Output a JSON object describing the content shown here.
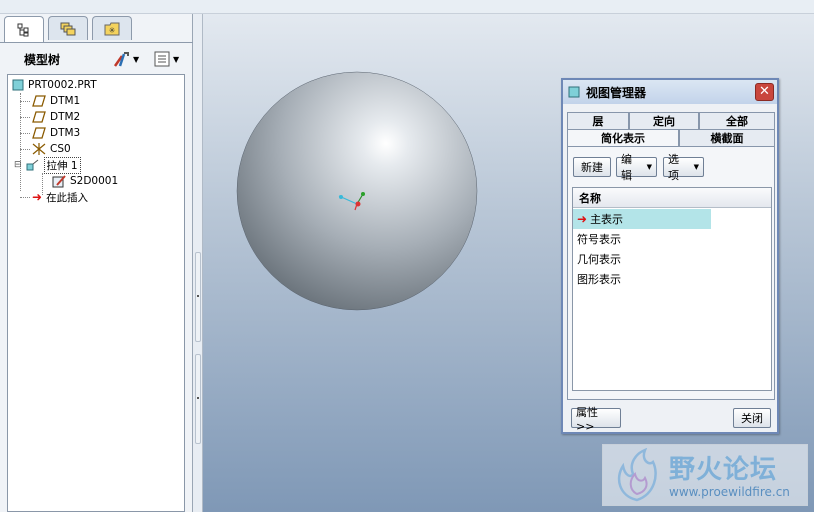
{
  "left_panel": {
    "title": "模型树",
    "tabs": [
      {
        "icon": "model-tree-icon",
        "active": true
      },
      {
        "icon": "layers-icon",
        "active": false
      },
      {
        "icon": "favorites-folder-icon",
        "active": false
      }
    ],
    "tree": {
      "root": "PRT0002.PRT",
      "items": [
        {
          "label": "DTM1",
          "icon": "datum-plane-icon"
        },
        {
          "label": "DTM2",
          "icon": "datum-plane-icon"
        },
        {
          "label": "DTM3",
          "icon": "datum-plane-icon"
        },
        {
          "label": "CS0",
          "icon": "coordinate-system-icon"
        },
        {
          "label": "拉伸 1",
          "icon": "extrude-icon"
        },
        {
          "label": "S2D0001",
          "icon": "sketch-icon"
        },
        {
          "label": "在此插入",
          "icon": "insert-here-arrow-icon"
        }
      ]
    }
  },
  "dialog": {
    "title": "视图管理器",
    "close_glyph": "✕",
    "tabs_row1": [
      "层",
      "定向",
      "全部"
    ],
    "tabs_row2": [
      "简化表示",
      "横截面"
    ],
    "active_tab": "简化表示",
    "buttons": {
      "new": "新建",
      "edit": "编辑",
      "options": "选项",
      "properties": "属性>>",
      "close": "关闭"
    },
    "list_header": "名称",
    "list_items": [
      {
        "label": "主表示",
        "active": true
      },
      {
        "label": "符号表示",
        "active": false
      },
      {
        "label": "几何表示",
        "active": false
      },
      {
        "label": "图形表示",
        "active": false
      }
    ]
  },
  "watermark": {
    "title": "野火论坛",
    "url": "www.proewildfire.cn"
  },
  "colors": {
    "selection": "#b3e4e8",
    "dialog_border": "#6e88b6",
    "close_red": "#c9463d"
  }
}
